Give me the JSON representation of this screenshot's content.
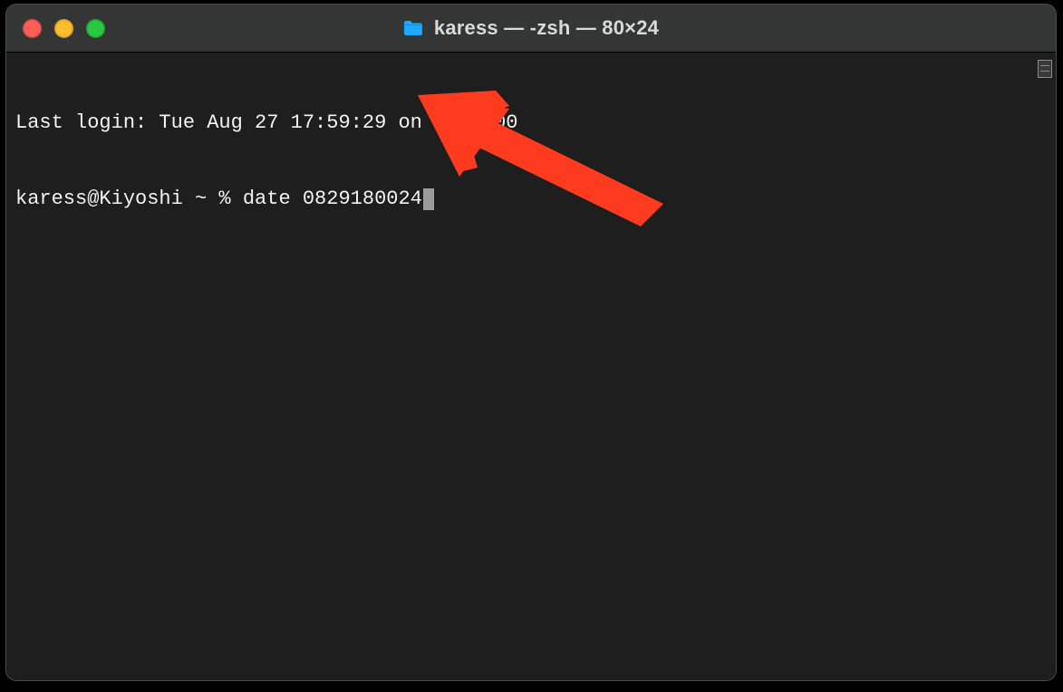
{
  "window": {
    "title": "karess — -zsh — 80×24"
  },
  "terminal": {
    "last_login_line": "Last login: Tue Aug 27 17:59:29 on ttys000",
    "prompt": "karess@Kiyoshi ~ % ",
    "command": "date 0829180024"
  },
  "annotation": {
    "arrow_color": "#ff3b1f"
  }
}
